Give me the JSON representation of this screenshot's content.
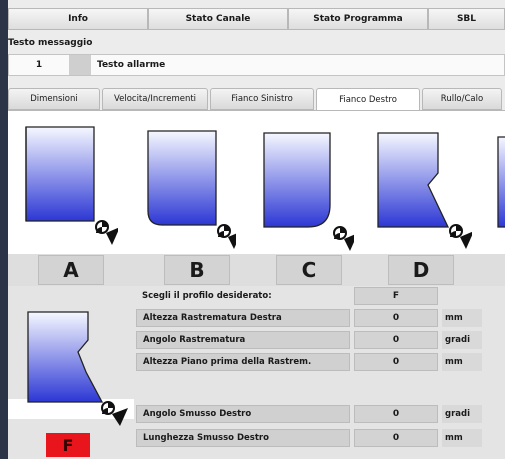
{
  "top_tabs": [
    "Info",
    "Stato Canale",
    "Stato Programma",
    "SBL"
  ],
  "message": {
    "section_label": "Testo messaggio",
    "number": "1",
    "text": "Testo allarme"
  },
  "sub_tabs": [
    "Dimensioni",
    "Velocita/Incrementi",
    "Fianco Sinistro",
    "Fianco Destro",
    "Rullo/Calo"
  ],
  "active_sub_tab": "Fianco Destro",
  "profiles": [
    {
      "letter": "A",
      "icon": "profile-square-icon"
    },
    {
      "letter": "B",
      "icon": "profile-radius-icon"
    },
    {
      "letter": "C",
      "icon": "profile-round-icon"
    },
    {
      "letter": "D",
      "icon": "profile-taper-icon"
    }
  ],
  "selected": {
    "letter": "F",
    "color": "#e8151c"
  },
  "params": [
    {
      "label": "Scegli il profilo desiderato:",
      "value": "F",
      "unit": ""
    },
    {
      "label": "Altezza Rastrematura Destra",
      "value": "0",
      "unit": "mm"
    },
    {
      "label": "Angolo Rastrematura",
      "value": "0",
      "unit": "gradi"
    },
    {
      "label": "Altezza Piano prima della Rastrem.",
      "value": "0",
      "unit": "mm"
    },
    {
      "label": "Angolo Smusso Destro",
      "value": "0",
      "unit": "gradi"
    },
    {
      "label": "Lunghezza Smusso Destro",
      "value": "0",
      "unit": "mm"
    }
  ],
  "colors": {
    "profile_top": "#f4f6ff",
    "profile_bottom": "#2f3ad6",
    "accent_red": "#e8151c"
  }
}
